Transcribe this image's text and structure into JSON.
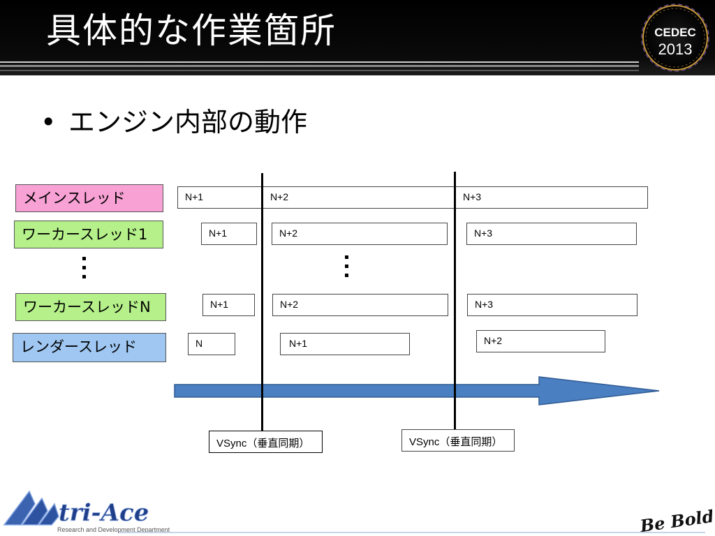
{
  "slide": {
    "title": "具体的な作業箇所"
  },
  "bullet": {
    "dot": "•",
    "text": "エンジン内部の動作"
  },
  "threads": [
    {
      "label": "メインスレッド",
      "color": "#f7a1d5"
    },
    {
      "label": "ワーカースレッド1",
      "color": "#b5f08a"
    },
    {
      "label": "ワーカースレッドN",
      "color": "#b5f08a"
    },
    {
      "label": "レンダースレッド",
      "color": "#9fc7f2"
    }
  ],
  "frames": {
    "main": [
      "N+1",
      "N+2",
      "N+3"
    ],
    "worker1": [
      "N+1",
      "N+2",
      "N+3"
    ],
    "workerN": [
      "N+1",
      "N+2",
      "N+3"
    ],
    "render": [
      "N",
      "N+1",
      "N+2"
    ]
  },
  "vsync": [
    "VSync（垂直同期）",
    "VSync（垂直同期）"
  ],
  "arrow_color": "#4a7fc1",
  "logos": {
    "cedec": "CEDEC",
    "cedec_year": "2013",
    "triace": "tri-Ace",
    "triace_sub": "Research and Development Department",
    "bebold": "Be Bold!"
  }
}
